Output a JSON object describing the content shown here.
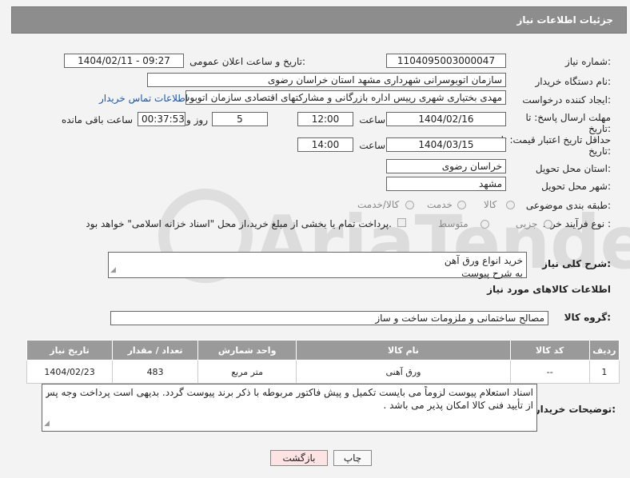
{
  "header": {
    "title": "جزئیات اطلاعات نیاز"
  },
  "fields": {
    "need_number_label": "شماره نیاز:",
    "need_number": "1104095003000047",
    "announce_label": "تاریخ و ساعت اعلان عمومی:",
    "announce_value": "1404/02/11 - 09:27",
    "buyer_org_label": "نام دستگاه خریدار:",
    "buyer_org": "سازمان اتوبوسرانی شهرداری مشهد استان خراسان رضوی",
    "creator_label": "ایجاد کننده درخواست:",
    "creator": "مهدی بختیاری شهری رییس اداره بازرگانی و مشارکتهای اقتصادی سازمان اتوبوس",
    "contact_link": "اطلاعات تماس خریدار",
    "reply_deadline_label": "مهلت ارسال پاسخ: تا تاریخ:",
    "reply_date": "1404/02/16",
    "time_label": "ساعت",
    "reply_time": "12:00",
    "days_value": "5",
    "days_label": "روز و",
    "remaining_time": "00:37:53",
    "remaining_label": "ساعت باقی مانده",
    "price_validity_label": "حداقل تاریخ اعتبار قیمت: تا تاریخ:",
    "price_date": "1404/03/15",
    "price_time": "14:00",
    "province_label": "استان محل تحویل:",
    "province": "خراسان رضوی",
    "city_label": "شهر محل تحویل:",
    "city": "مشهد",
    "category_label": "طبقه بندی موضوعی:",
    "cat_goods": "کالا",
    "cat_service": "خدمت",
    "cat_goods_service": "کالا/خدمت",
    "process_label": "نوع فرآیند خرید :",
    "proc_partial": "جزیی",
    "proc_medium": "متوسط",
    "payment_note": "پرداخت تمام یا بخشی از مبلغ خرید،از محل \"اسناد خزانه اسلامی\" خواهد بود."
  },
  "description": {
    "label": "شرح کلی نیاز:",
    "text_line1": "خرید انواع ورق آهن",
    "text_line2": "به شرح پیوست"
  },
  "goods_info": {
    "section_title": "اطلاعات کالاهای مورد نیاز",
    "group_label": "گروه کالا:",
    "group_value": "مصالح ساختمانی و ملزومات ساخت و ساز"
  },
  "table": {
    "headers": [
      "ردیف",
      "کد کالا",
      "نام کالا",
      "واحد شمارش",
      "تعداد / مقدار",
      "تاریخ نیاز"
    ],
    "rows": [
      [
        "1",
        "--",
        "ورق آهنی",
        "متر مربع",
        "483",
        "1404/02/23"
      ]
    ]
  },
  "buyer_notes": {
    "label": "توضیحات خریدار:",
    "text_line1": "اسناد استعلام پیوست لزوماً می بایست تکمیل و پیش فاکتور مربوطه با ذکر برند پیوست گردد. بدیهی است پرداخت وجه پس",
    "text_line2": "از تأیید فنی کالا امکان پذیر می باشد ."
  },
  "buttons": {
    "print": "چاپ",
    "back": "بازگشت"
  },
  "watermark": "AriaTender.net",
  "colors": {
    "header_bg": "#8d8d8d",
    "link": "#1a56b0",
    "back_btn_bg": "#fde3e3"
  }
}
